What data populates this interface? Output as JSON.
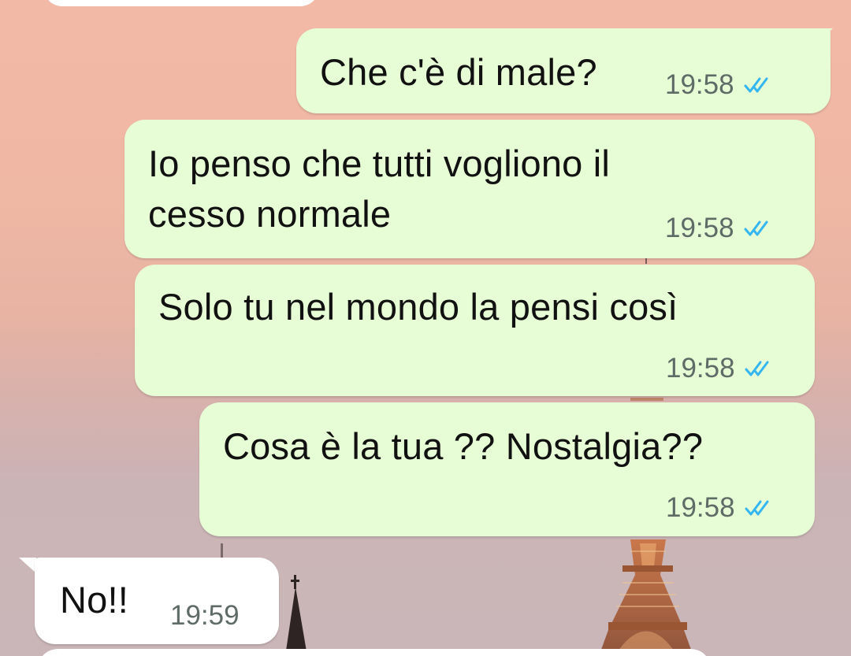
{
  "colors": {
    "outgoing_bubble": "#e6fdd6",
    "incoming_bubble": "#ffffff",
    "read_tick": "#34b7f1",
    "time_text": "#5f6b66"
  },
  "messages": [
    {
      "direction": "outgoing",
      "text": "Che c'è di male?",
      "time": "19:58",
      "status": "read-double-check-icon"
    },
    {
      "direction": "outgoing",
      "text_lines": [
        "Io penso che tutti vogliono il",
        "cesso normale"
      ],
      "time": "19:58",
      "status": "read-double-check-icon"
    },
    {
      "direction": "outgoing",
      "text": "Solo tu nel mondo la pensi così",
      "time": "19:58",
      "status": "read-double-check-icon"
    },
    {
      "direction": "outgoing",
      "text": "Cosa è la tua ?? Nostalgia??",
      "time": "19:58",
      "status": "read-double-check-icon"
    },
    {
      "direction": "incoming",
      "text": "No!!",
      "time": "19:59"
    }
  ]
}
